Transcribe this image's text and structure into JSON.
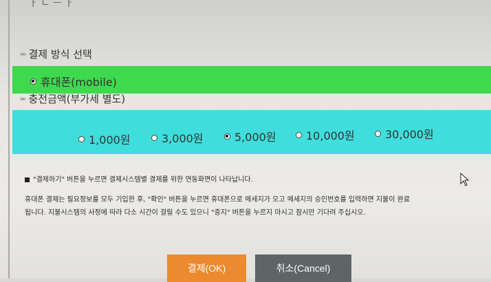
{
  "top_fragment": "ㅏ ㄴ ㅡ ㅏ",
  "payment_section": {
    "title": "결제 방식 선택",
    "options": [
      {
        "label": "휴대폰(mobile)",
        "selected": true
      }
    ]
  },
  "amount_section": {
    "title": "충전금액(부가세 별도)",
    "options": [
      {
        "label": "1,000원",
        "selected": false
      },
      {
        "label": "3,000원",
        "selected": false
      },
      {
        "label": "5,000원",
        "selected": true
      },
      {
        "label": "10,000원",
        "selected": false
      },
      {
        "label": "30,000원",
        "selected": false
      }
    ]
  },
  "notice": {
    "line1": "\"결제하기\" 버튼을 누르면 결제시스템별 결제를 위한 연동화면이 나타납니다.",
    "line2": "휴대폰 결제는 필요정보를 모두 기입한 후, \"확인\" 버튼을 누르면 휴대폰으로 메세지가 오고 메세지의 승인번호를 입력하면 지불이 완료",
    "line3": "됩니다. 지불시스템의 사정에 따라 다소 시간이 걸릴 수도 있으니 \"중지\" 버튼을 누르지 마시고 잠시만 기다려 주십시오."
  },
  "buttons": {
    "ok_label": "결제(OK)",
    "cancel_label": "취소(Cancel)"
  },
  "colors": {
    "payment_band": "#3fd94e",
    "amount_band": "#3fdedc",
    "ok_button": "#ec8a2f",
    "cancel_button": "#5d6566"
  }
}
